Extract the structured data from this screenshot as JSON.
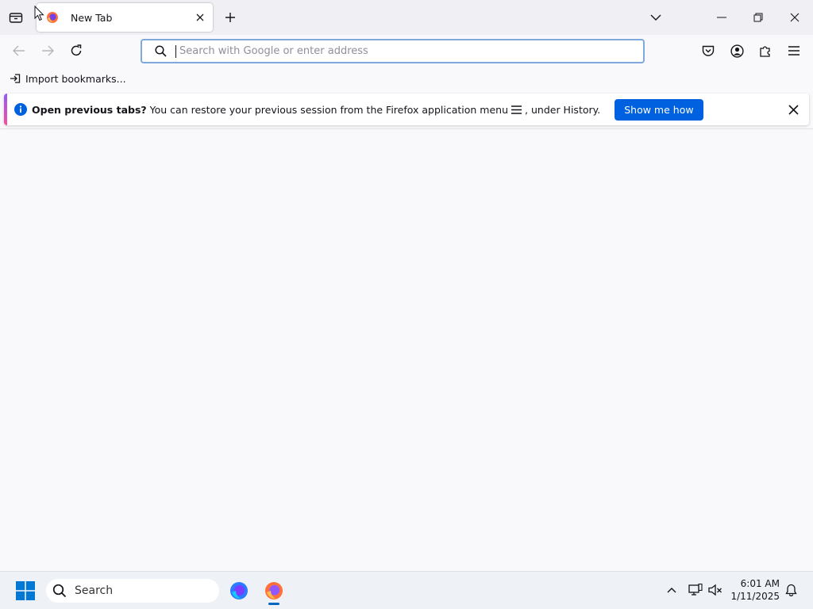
{
  "tabbar": {
    "tab_title": "New Tab",
    "icons": [
      "tab-overview-icon",
      "firefox-favicon-icon",
      "close-tab-icon",
      "new-tab-plus-icon",
      "tab-list-chevron-icon"
    ]
  },
  "window_controls": {
    "icons": [
      "minimize-icon",
      "restore-icon",
      "close-window-icon"
    ]
  },
  "navbar": {
    "icons": [
      "back-arrow-icon",
      "forward-arrow-icon",
      "reload-icon",
      "pocket-icon",
      "account-icon",
      "extensions-icon",
      "hamburger-menu-icon"
    ],
    "urlbar": {
      "placeholder": "Search with Google or enter address",
      "value": ""
    }
  },
  "bookmarks": {
    "import_label": "Import bookmarks..."
  },
  "infobar": {
    "title": "Open previous tabs?",
    "message_before": "You can restore your previous session from the Firefox application menu",
    "message_after": ", under History.",
    "button_label": "Show me how",
    "accent_colors": [
      "#9059ff",
      "#ff4aa2"
    ],
    "button_color": "#0061e0"
  },
  "taskbar": {
    "search_label": "Search",
    "time": "6:01 AM",
    "date": "1/11/2025",
    "icons": [
      "windows-start-icon",
      "taskbar-search-icon",
      "firefox-dev-app-icon",
      "firefox-app-icon",
      "show-hidden-icons-chevron",
      "network-icon",
      "volume-muted-icon",
      "notification-bell-icon"
    ]
  }
}
